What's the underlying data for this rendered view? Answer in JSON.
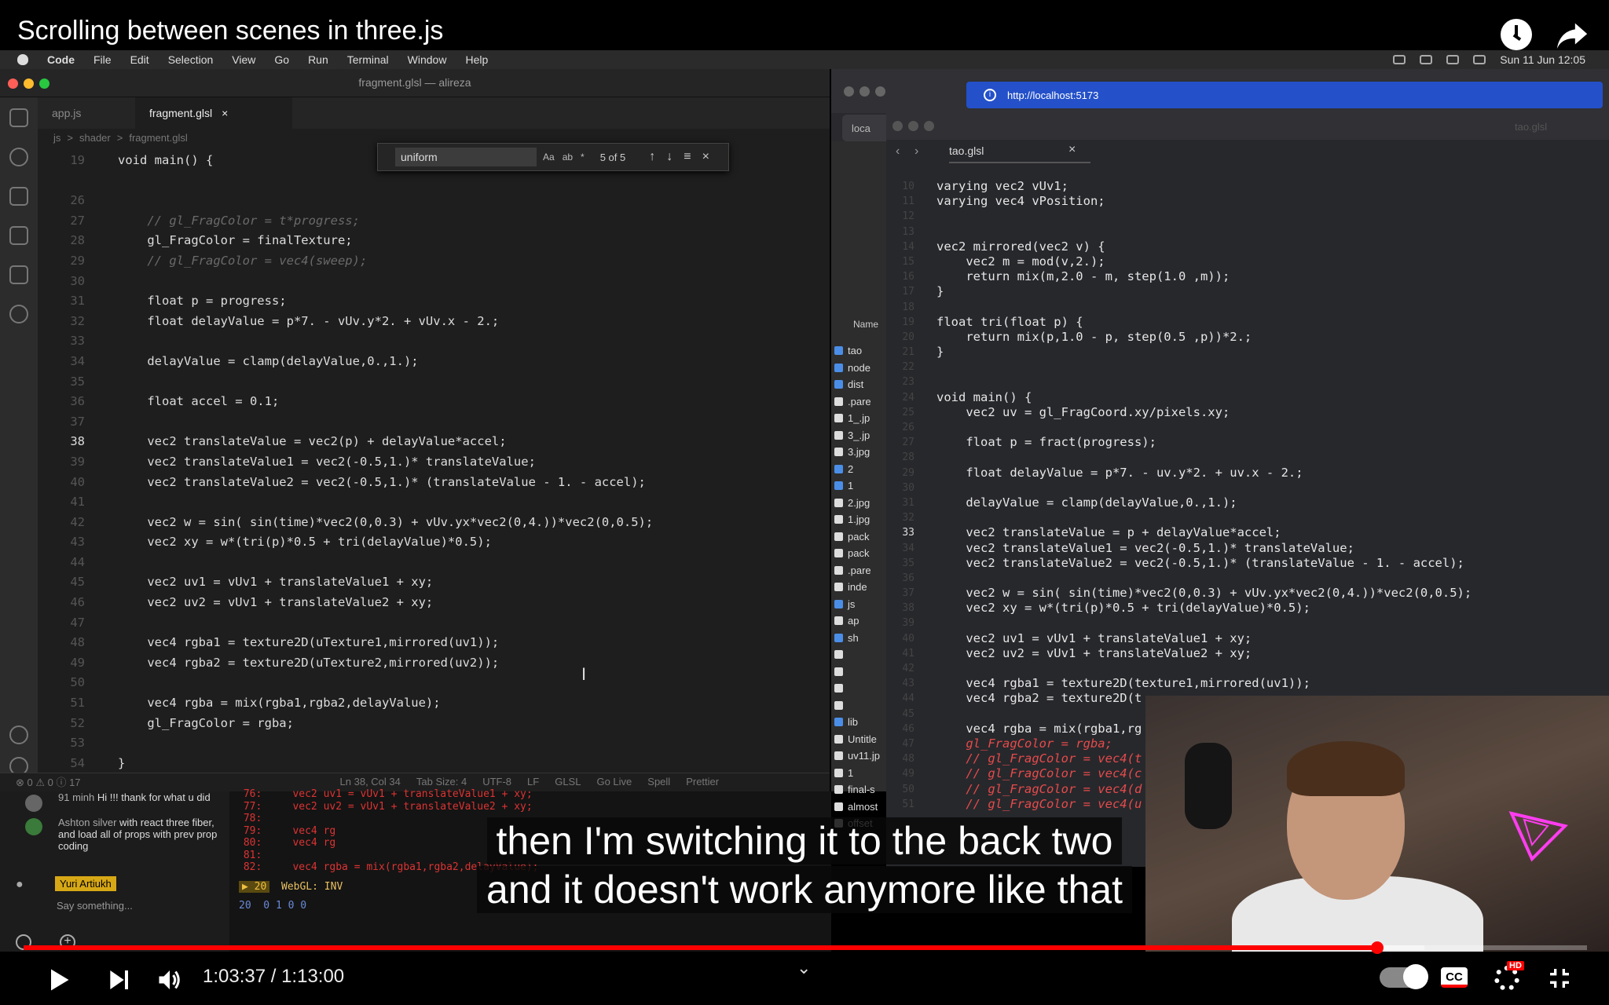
{
  "video": {
    "title": "Scrolling between scenes in three.js"
  },
  "menubar": {
    "items": [
      "Code",
      "File",
      "Edit",
      "Selection",
      "View",
      "Go",
      "Run",
      "Terminal",
      "Window",
      "Help"
    ],
    "clock": "Sun 11 Jun  12:05"
  },
  "vscode": {
    "window_title": "fragment.glsl — alireza",
    "tabs": [
      {
        "label": "app.js"
      },
      {
        "label": "fragment.glsl"
      }
    ],
    "breadcrumb": [
      "js",
      ">",
      "shader",
      ">",
      "fragment.glsl"
    ],
    "find": {
      "value": "uniform",
      "count": "5 of 5",
      "options": [
        "Aa",
        "ab",
        "*"
      ]
    },
    "code_lines": [
      {
        "n": "19",
        "t": "void main() {"
      },
      {
        "n": "",
        "t": ""
      },
      {
        "n": "26",
        "t": ""
      },
      {
        "n": "27",
        "t": "    // gl_FragColor = t*progress;",
        "c": 1
      },
      {
        "n": "28",
        "t": "    gl_FragColor = finalTexture;"
      },
      {
        "n": "29",
        "t": "    // gl_FragColor = vec4(sweep);",
        "c": 1
      },
      {
        "n": "30",
        "t": ""
      },
      {
        "n": "31",
        "t": "    float p = progress;"
      },
      {
        "n": "32",
        "t": "    float delayValue = p*7. - vUv.y*2. + vUv.x - 2.;"
      },
      {
        "n": "33",
        "t": ""
      },
      {
        "n": "34",
        "t": "    delayValue = clamp(delayValue,0.,1.);"
      },
      {
        "n": "35",
        "t": ""
      },
      {
        "n": "36",
        "t": "    float accel = 0.1;"
      },
      {
        "n": "37",
        "t": ""
      },
      {
        "n": "38",
        "t": "    vec2 translateValue = vec2(p) + delayValue*accel;",
        "cur": 1
      },
      {
        "n": "39",
        "t": "    vec2 translateValue1 = vec2(-0.5,1.)* translateValue;"
      },
      {
        "n": "40",
        "t": "    vec2 translateValue2 = vec2(-0.5,1.)* (translateValue - 1. - accel);"
      },
      {
        "n": "41",
        "t": ""
      },
      {
        "n": "42",
        "t": "    vec2 w = sin( sin(time)*vec2(0,0.3) + vUv.yx*vec2(0,4.))*vec2(0,0.5);"
      },
      {
        "n": "43",
        "t": "    vec2 xy = w*(tri(p)*0.5 + tri(delayValue)*0.5);"
      },
      {
        "n": "44",
        "t": ""
      },
      {
        "n": "45",
        "t": "    vec2 uv1 = vUv1 + translateValue1 + xy;"
      },
      {
        "n": "46",
        "t": "    vec2 uv2 = vUv1 + translateValue2 + xy;"
      },
      {
        "n": "47",
        "t": ""
      },
      {
        "n": "48",
        "t": "    vec4 rgba1 = texture2D(uTexture1,mirrored(uv1));"
      },
      {
        "n": "49",
        "t": "    vec4 rgba2 = texture2D(uTexture2,mirrored(uv2));"
      },
      {
        "n": "50",
        "t": ""
      },
      {
        "n": "51",
        "t": "    vec4 rgba = mix(rgba1,rgba2,delayValue);"
      },
      {
        "n": "52",
        "t": "    gl_FragColor = rgba;"
      },
      {
        "n": "53",
        "t": ""
      },
      {
        "n": "54",
        "t": "}"
      }
    ],
    "status": {
      "problems": "⊗ 0 ⚠ 0 ⓘ 17",
      "position": "Ln 38, Col 34",
      "tab_size": "Tab Size: 4",
      "encoding": "UTF-8",
      "eol": "LF",
      "lang": "GLSL",
      "golive": "Go Live",
      "spell": "Spell",
      "prettier": "Prettier"
    }
  },
  "browser": {
    "url": "http://localhost:5173",
    "inner_tab": "loca",
    "finder_header": "Name",
    "finder_items": [
      {
        "l": "tao",
        "f": 1
      },
      {
        "l": "node",
        "f": 1
      },
      {
        "l": "dist",
        "f": 1
      },
      {
        "l": ".pare",
        "f": 0
      },
      {
        "l": "1_.jp",
        "f": 0
      },
      {
        "l": "3_.jp",
        "f": 0
      },
      {
        "l": "3.jpg",
        "f": 0
      },
      {
        "l": "2",
        "f": 1
      },
      {
        "l": "1",
        "f": 1
      },
      {
        "l": "2.jpg",
        "f": 0
      },
      {
        "l": "1.jpg",
        "f": 0
      },
      {
        "l": "pack",
        "f": 0
      },
      {
        "l": "pack",
        "f": 0
      },
      {
        "l": ".pare",
        "f": 0
      },
      {
        "l": "inde",
        "f": 0
      },
      {
        "l": "js",
        "f": 1
      },
      {
        "l": "ap",
        "f": 0
      },
      {
        "l": "sh",
        "f": 1
      },
      {
        "l": "",
        "f": 0
      },
      {
        "l": "",
        "f": 0
      },
      {
        "l": "",
        "f": 0
      },
      {
        "l": "",
        "f": 0
      },
      {
        "l": "lib",
        "f": 1
      },
      {
        "l": "Untitle",
        "f": 0
      },
      {
        "l": "uv11.jp",
        "f": 0
      },
      {
        "l": "1",
        "f": 0
      },
      {
        "l": "final-s",
        "f": 0
      },
      {
        "l": "almost",
        "f": 0
      },
      {
        "l": "offset",
        "f": 0
      }
    ]
  },
  "editor2": {
    "file_label": "tao.glsl",
    "tab": "tao.glsl",
    "code_lines": [
      {
        "n": "10",
        "t": "varying vec2 vUv1;"
      },
      {
        "n": "11",
        "t": "varying vec4 vPosition;"
      },
      {
        "n": "12",
        "t": ""
      },
      {
        "n": "13",
        "t": ""
      },
      {
        "n": "14",
        "t": "vec2 mirrored(vec2 v) {"
      },
      {
        "n": "15",
        "t": "    vec2 m = mod(v,2.);"
      },
      {
        "n": "16",
        "t": "    return mix(m,2.0 - m, step(1.0 ,m));"
      },
      {
        "n": "17",
        "t": "}"
      },
      {
        "n": "18",
        "t": ""
      },
      {
        "n": "19",
        "t": "float tri(float p) {"
      },
      {
        "n": "20",
        "t": "    return mix(p,1.0 - p, step(0.5 ,p))*2.;"
      },
      {
        "n": "21",
        "t": "}"
      },
      {
        "n": "22",
        "t": ""
      },
      {
        "n": "23",
        "t": ""
      },
      {
        "n": "24",
        "t": "void main() {"
      },
      {
        "n": "25",
        "t": "    vec2 uv = gl_FragCoord.xy/pixels.xy;"
      },
      {
        "n": "26",
        "t": ""
      },
      {
        "n": "27",
        "t": "    float p = fract(progress);"
      },
      {
        "n": "28",
        "t": ""
      },
      {
        "n": "29",
        "t": "    float delayValue = p*7. - uv.y*2. + uv.x - 2.;"
      },
      {
        "n": "30",
        "t": ""
      },
      {
        "n": "31",
        "t": "    delayValue = clamp(delayValue,0.,1.);"
      },
      {
        "n": "32",
        "t": ""
      },
      {
        "n": "33",
        "t": "    vec2 translateValue = p + delayValue*accel;",
        "cur": 1
      },
      {
        "n": "34",
        "t": "    vec2 translateValue1 = vec2(-0.5,1.)* translateValue;"
      },
      {
        "n": "35",
        "t": "    vec2 translateValue2 = vec2(-0.5,1.)* (translateValue - 1. - accel);"
      },
      {
        "n": "36",
        "t": ""
      },
      {
        "n": "37",
        "t": "    vec2 w = sin( sin(time)*vec2(0,0.3) + vUv.yx*vec2(0,4.))*vec2(0,0.5);"
      },
      {
        "n": "38",
        "t": "    vec2 xy = w*(tri(p)*0.5 + tri(delayValue)*0.5);"
      },
      {
        "n": "39",
        "t": ""
      },
      {
        "n": "40",
        "t": "    vec2 uv1 = vUv1 + translateValue1 + xy;"
      },
      {
        "n": "41",
        "t": "    vec2 uv2 = vUv1 + translateValue2 + xy;"
      },
      {
        "n": "42",
        "t": ""
      },
      {
        "n": "43",
        "t": "    vec4 rgba1 = texture2D(texture1,mirrored(uv1));"
      },
      {
        "n": "44",
        "t": "    vec4 rgba2 = texture2D(t"
      },
      {
        "n": "45",
        "t": ""
      },
      {
        "n": "46",
        "t": "    vec4 rgba = mix(rgba1,rg"
      },
      {
        "n": "47",
        "t": "    gl_FragColor = rgba;",
        "c": 1
      },
      {
        "n": "48",
        "t": "    // gl_FragColor = vec4(t",
        "c": 1
      },
      {
        "n": "49",
        "t": "    // gl_FragColor = vec4(c",
        "c": 1
      },
      {
        "n": "50",
        "t": "    // gl_FragColor = vec4(d",
        "c": 1
      },
      {
        "n": "51",
        "t": "    // gl_FragColor = vec4(u",
        "c": 1
      }
    ]
  },
  "console": {
    "lines": [
      " 76:     vec2 uv1 = vUv1 + translateValue1 + xy;",
      " 77:     vec2 uv2 = vUv1 + translateValue2 + xy;",
      " 78:",
      " 79:     vec4 rg",
      " 80:     vec4 rg",
      " 81:",
      " 82:     vec4 rgba = mix(rgba1,rgba2,delayValue);"
    ],
    "warn_badge": "▶ 20",
    "warn_text": "WebGL: INV",
    "counter": "20  0 1 0 0"
  },
  "chat": {
    "msg1_user": "91 minh",
    "msg1_text": "Hi !!! thank for what u did",
    "msg2_user": "Ashton silver",
    "msg2_text": "with react three fiber, and load all of props with prev prop coding",
    "author": "Yuri Artiukh",
    "placeholder": "Say something..."
  },
  "captions": {
    "line1": "then I'm switching it to the back two",
    "line2": "and it doesn't work anymore like that"
  },
  "player": {
    "time": "1:03:37 / 1:13:00",
    "progress": 0.866,
    "buffered": 0.896,
    "cc_label": "CC",
    "hd_label": "HD"
  },
  "colors": {
    "accent": "#ff0000",
    "url_bar": "#2451c9",
    "badge": "#d7a816"
  }
}
